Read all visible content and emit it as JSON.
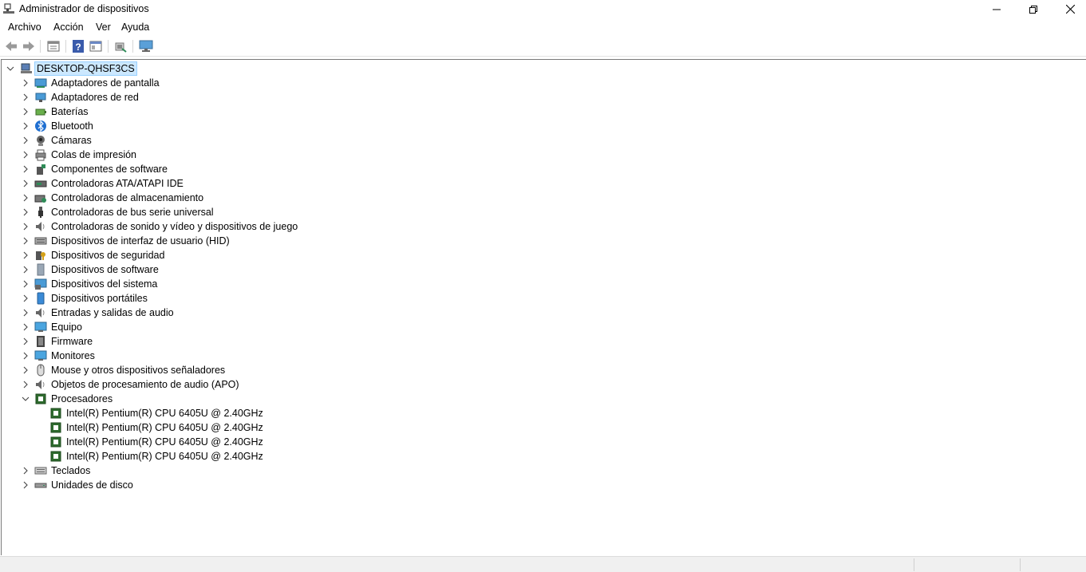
{
  "window": {
    "title": "Administrador de dispositivos"
  },
  "menu": [
    "Archivo",
    "Acción",
    "Ver",
    "Ayuda"
  ],
  "toolbar": [
    "back-icon",
    "forward-icon",
    "properties-icon",
    "help-icon",
    "view-icon",
    "scan-hardware-icon",
    "monitor-icon"
  ],
  "tree": {
    "root": "DESKTOP-QHSF3CS",
    "categories": [
      {
        "label": "Adaptadores de pantalla",
        "icon": "display-adapter-icon"
      },
      {
        "label": "Adaptadores de red",
        "icon": "network-adapter-icon"
      },
      {
        "label": "Baterías",
        "icon": "battery-icon"
      },
      {
        "label": "Bluetooth",
        "icon": "bluetooth-icon"
      },
      {
        "label": "Cámaras",
        "icon": "camera-icon"
      },
      {
        "label": "Colas de impresión",
        "icon": "printer-icon"
      },
      {
        "label": "Componentes de software",
        "icon": "software-component-icon"
      },
      {
        "label": "Controladoras ATA/ATAPI IDE",
        "icon": "ide-controller-icon"
      },
      {
        "label": "Controladoras de almacenamiento",
        "icon": "storage-controller-icon"
      },
      {
        "label": "Controladoras de bus serie universal",
        "icon": "usb-icon"
      },
      {
        "label": "Controladoras de sonido y vídeo y dispositivos de juego",
        "icon": "sound-icon"
      },
      {
        "label": "Dispositivos de interfaz de usuario (HID)",
        "icon": "hid-icon"
      },
      {
        "label": "Dispositivos de seguridad",
        "icon": "security-device-icon"
      },
      {
        "label": "Dispositivos de software",
        "icon": "software-device-icon"
      },
      {
        "label": "Dispositivos del sistema",
        "icon": "system-device-icon"
      },
      {
        "label": "Dispositivos portátiles",
        "icon": "portable-device-icon"
      },
      {
        "label": "Entradas y salidas de audio",
        "icon": "audio-io-icon"
      },
      {
        "label": "Equipo",
        "icon": "computer-icon"
      },
      {
        "label": "Firmware",
        "icon": "firmware-icon"
      },
      {
        "label": "Monitores",
        "icon": "monitor-icon"
      },
      {
        "label": "Mouse y otros dispositivos señaladores",
        "icon": "mouse-icon"
      },
      {
        "label": "Objetos de procesamiento de audio (APO)",
        "icon": "apo-icon"
      },
      {
        "label": "Procesadores",
        "icon": "processor-icon",
        "expanded": true,
        "children": [
          "Intel(R) Pentium(R) CPU 6405U @ 2.40GHz",
          "Intel(R) Pentium(R) CPU 6405U @ 2.40GHz",
          "Intel(R) Pentium(R) CPU 6405U @ 2.40GHz",
          "Intel(R) Pentium(R) CPU 6405U @ 2.40GHz"
        ]
      },
      {
        "label": "Teclados",
        "icon": "keyboard-icon"
      },
      {
        "label": "Unidades de disco",
        "icon": "disk-drive-icon"
      }
    ]
  }
}
